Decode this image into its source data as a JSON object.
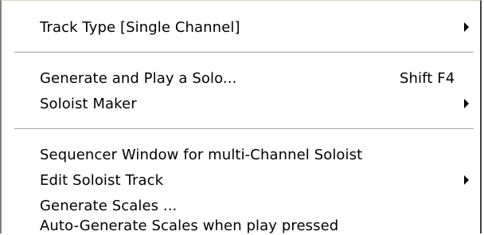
{
  "menu": {
    "groups": [
      {
        "items": [
          {
            "label": "Track Type [Single Channel]",
            "shortcut": "",
            "submenu": true
          }
        ]
      },
      {
        "items": [
          {
            "label": "Generate and Play a Solo...",
            "shortcut": "Shift F4",
            "submenu": false
          },
          {
            "label": "Soloist Maker",
            "shortcut": "",
            "submenu": true
          }
        ]
      },
      {
        "items": [
          {
            "label": "Sequencer Window for multi-Channel Soloist",
            "shortcut": "",
            "submenu": false
          },
          {
            "label": "Edit Soloist Track",
            "shortcut": "",
            "submenu": true
          },
          {
            "label": "Generate Scales ...",
            "shortcut": "",
            "submenu": false
          },
          {
            "label": "Auto-Generate Scales when play pressed",
            "shortcut": "",
            "submenu": false
          }
        ]
      }
    ]
  },
  "colors": {
    "background": "#ffffff",
    "text": "#000000",
    "separator": "#a0a0a0",
    "border": "#808080"
  }
}
